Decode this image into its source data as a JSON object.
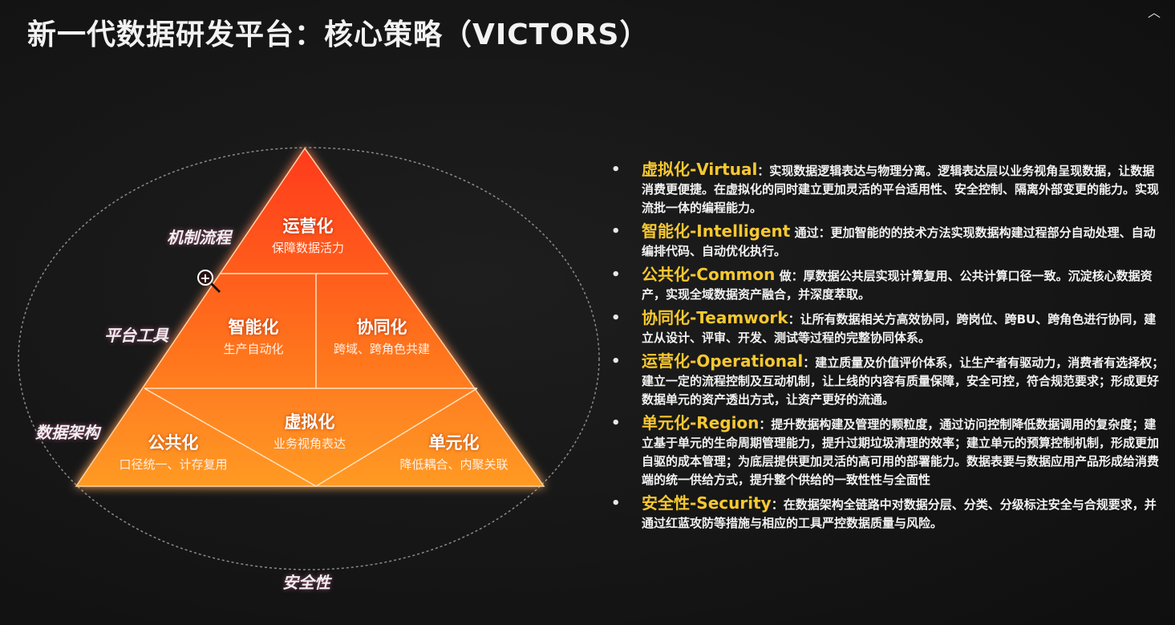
{
  "title": "新一代数据研发平台：核心策略（VICTORS）",
  "corner_icon": "chevron-up-icon",
  "side_labels": {
    "mechanism": "机制流程",
    "platform": "平台工具",
    "architecture": "数据架构",
    "security": "安全性"
  },
  "pyramid": {
    "top": {
      "title": "运营化",
      "subtitle": "保障数据活力"
    },
    "mid_left": {
      "title": "智能化",
      "subtitle": "生产自动化"
    },
    "mid_right": {
      "title": "协同化",
      "subtitle": "跨域、跨角色共建"
    },
    "bottom_left": {
      "title": "公共化",
      "subtitle": "口径统一、计存复用"
    },
    "bottom_center": {
      "title": "虚拟化",
      "subtitle": "业务视角表达"
    },
    "bottom_right": {
      "title": "单元化",
      "subtitle": "降低耦合、内聚关联"
    }
  },
  "colors": {
    "pyramid_top": "#ff3a1a",
    "pyramid_bottom": "#ff9a22",
    "term": "#f7c830"
  },
  "items": [
    {
      "term": "虚拟化-Virtual",
      "desc": "：实现数据逻辑表达与物理分离。逻辑表达层以业务视角呈现数据，让数据消费更便捷。在虚拟化的同时建立更加灵活的平台适用性、安全控制、隔离外部变更的能力。实现流批一体的编程能力。"
    },
    {
      "term": "智能化-Intelligent",
      "desc": " 通过：更加智能的的技术方法实现数据构建过程部分自动处理、自动编排代码、自动优化执行。"
    },
    {
      "term": "公共化-Common",
      "desc": " 做：厚数据公共层实现计算复用、公共计算口径一致。沉淀核心数据资产，实现全域数据资产融合，并深度萃取。"
    },
    {
      "term": "协同化-Teamwork",
      "desc": "：让所有数据相关方高效协同，跨岗位、跨BU、跨角色进行协同，建立从设计、评审、开发、测试等过程的完整协同体系。"
    },
    {
      "term": "运营化-Operational",
      "desc": "：建立质量及价值评价体系，让生产者有驱动力，消费者有选择权；建立一定的流程控制及互动机制，让上线的内容有质量保障，安全可控，符合规范要求；形成更好数据单元的资产透出方式，让资产更好的流通。"
    },
    {
      "term": "单元化-Region",
      "desc": "：提升数据构建及管理的颗粒度，通过访问控制降低数据调用的复杂度；建立基于单元的生命周期管理能力，提升过期垃圾清理的效率；建立单元的预算控制机制，形成更加自驱的成本管理；为底层提供更加灵活的高可用的部署能力。数据表要与数据应用产品形成给消费端的统一供给方式，提升整个供给的一致性性与全面性"
    },
    {
      "term": "安全性-Security",
      "desc": "：在数据架构全链路中对数据分层、分类、分级标注安全与合规要求，并通过红蓝攻防等措施与相应的工具严控数据质量与风险。"
    }
  ]
}
